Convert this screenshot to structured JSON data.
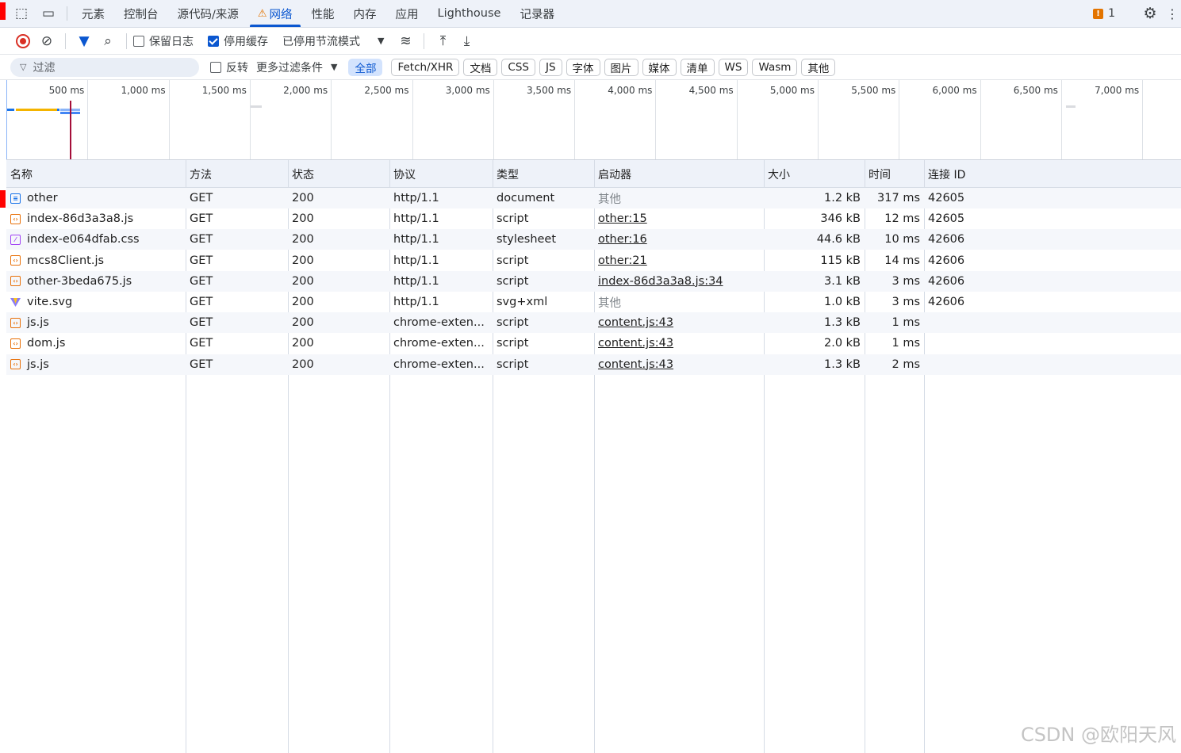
{
  "tabs": [
    {
      "label": "元素",
      "active": false
    },
    {
      "label": "控制台",
      "active": false
    },
    {
      "label": "源代码/来源",
      "active": false
    },
    {
      "label": "网络",
      "active": true
    },
    {
      "label": "性能",
      "active": false
    },
    {
      "label": "内存",
      "active": false
    },
    {
      "label": "应用",
      "active": false
    },
    {
      "label": "Lighthouse",
      "active": false
    },
    {
      "label": "记录器",
      "active": false
    }
  ],
  "issues_count": "1",
  "toolbar": {
    "preserve_log": "保留日志",
    "disable_cache": "停用缓存",
    "throttling": "已停用节流模式"
  },
  "filter": {
    "placeholder": "过滤",
    "invert": "反转",
    "more_filters": "更多过滤条件",
    "chips": [
      "全部",
      "Fetch/XHR",
      "文档",
      "CSS",
      "JS",
      "字体",
      "图片",
      "媒体",
      "清单",
      "WS",
      "Wasm",
      "其他"
    ]
  },
  "timeline_labels": [
    "500 ms",
    "1,000 ms",
    "1,500 ms",
    "2,000 ms",
    "2,500 ms",
    "3,000 ms",
    "3,500 ms",
    "4,000 ms",
    "4,500 ms",
    "5,000 ms",
    "5,500 ms",
    "6,000 ms",
    "6,500 ms",
    "7,000 ms"
  ],
  "columns": [
    "名称",
    "方法",
    "状态",
    "协议",
    "类型",
    "启动器",
    "大小",
    "时间",
    "连接 ID"
  ],
  "rows": [
    {
      "icon": "document",
      "name": "other",
      "method": "GET",
      "status": "200",
      "protocol": "http/1.1",
      "type": "document",
      "initiator": "其他",
      "initiator_link": false,
      "size": "1.2 kB",
      "time": "317 ms",
      "conn": "42605"
    },
    {
      "icon": "script",
      "name": "index-86d3a3a8.js",
      "method": "GET",
      "status": "200",
      "protocol": "http/1.1",
      "type": "script",
      "initiator": "other:15",
      "initiator_link": true,
      "size": "346 kB",
      "time": "12 ms",
      "conn": "42605"
    },
    {
      "icon": "stylesheet",
      "name": "index-e064dfab.css",
      "method": "GET",
      "status": "200",
      "protocol": "http/1.1",
      "type": "stylesheet",
      "initiator": "other:16",
      "initiator_link": true,
      "size": "44.6 kB",
      "time": "10 ms",
      "conn": "42606"
    },
    {
      "icon": "script",
      "name": "mcs8Client.js",
      "method": "GET",
      "status": "200",
      "protocol": "http/1.1",
      "type": "script",
      "initiator": "other:21",
      "initiator_link": true,
      "size": "115 kB",
      "time": "14 ms",
      "conn": "42606"
    },
    {
      "icon": "script",
      "name": "other-3beda675.js",
      "method": "GET",
      "status": "200",
      "protocol": "http/1.1",
      "type": "script",
      "initiator": "index-86d3a3a8.js:34",
      "initiator_link": true,
      "size": "3.1 kB",
      "time": "3 ms",
      "conn": "42606"
    },
    {
      "icon": "svg",
      "name": "vite.svg",
      "method": "GET",
      "status": "200",
      "protocol": "http/1.1",
      "type": "svg+xml",
      "initiator": "其他",
      "initiator_link": false,
      "size": "1.0 kB",
      "time": "3 ms",
      "conn": "42606"
    },
    {
      "icon": "script",
      "name": "js.js",
      "method": "GET",
      "status": "200",
      "protocol": "chrome-exten...",
      "type": "script",
      "initiator": "content.js:43",
      "initiator_link": true,
      "size": "1.3 kB",
      "time": "1 ms",
      "conn": ""
    },
    {
      "icon": "script",
      "name": "dom.js",
      "method": "GET",
      "status": "200",
      "protocol": "chrome-exten...",
      "type": "script",
      "initiator": "content.js:43",
      "initiator_link": true,
      "size": "2.0 kB",
      "time": "1 ms",
      "conn": ""
    },
    {
      "icon": "script",
      "name": "js.js",
      "method": "GET",
      "status": "200",
      "protocol": "chrome-exten...",
      "type": "script",
      "initiator": "content.js:43",
      "initiator_link": true,
      "size": "1.3 kB",
      "time": "2 ms",
      "conn": ""
    }
  ],
  "watermark": "CSDN @欧阳天风",
  "colors": {
    "accent": "#0b57d0",
    "record": "#d93025",
    "warning": "#e37400"
  }
}
